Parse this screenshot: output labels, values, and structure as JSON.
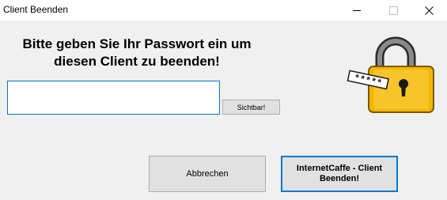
{
  "window": {
    "title": "Client Beenden",
    "minimize_icon": "minimize-icon",
    "maximize_icon": "maximize-icon",
    "close_icon": "close-icon"
  },
  "prompt": {
    "text": "Bitte geben Sie Ihr Passwort ein um diesen Client zu beenden!"
  },
  "password": {
    "value": "",
    "placeholder": ""
  },
  "buttons": {
    "show_label": "Sichtbar!",
    "cancel_label": "Abbrechen",
    "end_label": "InternetCaffe - Client Beenden!"
  },
  "lock_image": {
    "icon": "padlock-password-icon",
    "mask_text": "*****",
    "accent_color": "#f2b705"
  }
}
